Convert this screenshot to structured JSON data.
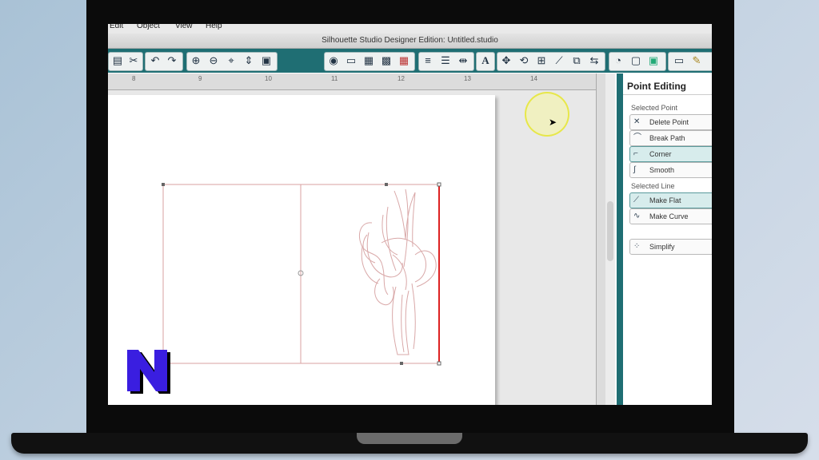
{
  "menu": [
    "Edit",
    "Object",
    "View",
    "Help"
  ],
  "window_title": "Silhouette Studio Designer Edition: Untitled.studio",
  "toolbar": {
    "groups": [
      [
        "paste-icon",
        "cut-icon"
      ],
      [
        "undo-icon",
        "redo-icon"
      ],
      [
        "zoom-in-icon",
        "zoom-out-icon",
        "zoom-select-icon",
        "zoom-fit-icon",
        "page-fit-icon"
      ],
      [
        "fill-icon",
        "color-icon",
        "pattern-icon",
        "gradient-icon",
        "grid-icon"
      ],
      [
        "line-style-icon",
        "line-weight-icon",
        "line-cut-icon"
      ],
      [
        "text-icon"
      ],
      [
        "move-icon",
        "rotate-icon",
        "scale-icon",
        "knife-icon",
        "replicate-icon",
        "mirror-icon"
      ],
      [
        "cut-settings-icon",
        "page-settings-icon",
        "registration-icon"
      ],
      [
        "draw-rect-icon",
        "pencil-icon"
      ]
    ]
  },
  "ruler_ticks": [
    "8",
    "9",
    "10",
    "11",
    "12",
    "13",
    "14"
  ],
  "panel": {
    "title": "Point Editing",
    "selected_point_label": "Selected Point",
    "selected_line_label": "Selected Line",
    "buttons": {
      "delete_point": "Delete Point",
      "break_path": "Break Path",
      "corner": "Corner",
      "smooth": "Smooth",
      "make_flat": "Make Flat",
      "make_curve": "Make Curve",
      "simplify": "Simplify"
    }
  },
  "colors": {
    "toolbar": "#1f6e73",
    "selection": "#c25a5a",
    "logo": "#3a1ee0"
  }
}
